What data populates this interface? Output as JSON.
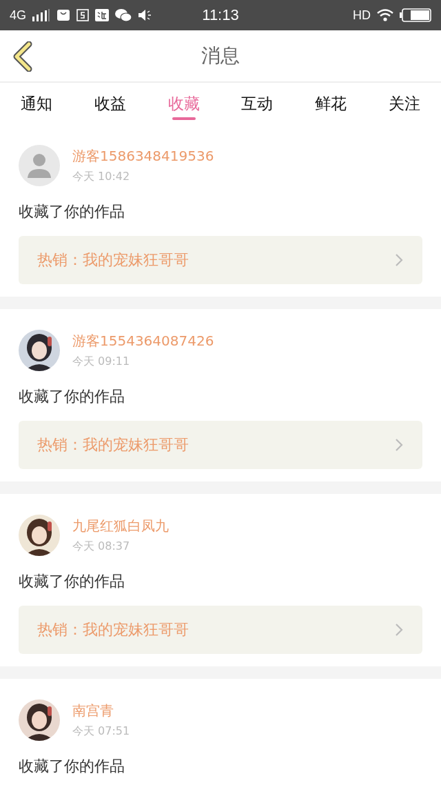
{
  "status_bar": {
    "network": "4G",
    "time": "11:13",
    "hd": "HD"
  },
  "header": {
    "title": "消息"
  },
  "tabs": [
    {
      "label": "通知",
      "selected": false
    },
    {
      "label": "收益",
      "selected": false
    },
    {
      "label": "收藏",
      "selected": true
    },
    {
      "label": "互动",
      "selected": false
    },
    {
      "label": "鲜花",
      "selected": false
    },
    {
      "label": "关注",
      "selected": false
    }
  ],
  "messages": [
    {
      "kind": "default",
      "name": "游客1586348419536",
      "time": "今天 10:42",
      "action": "收藏了你的作品",
      "link": "热销：我的宠妹狂哥哥"
    },
    {
      "kind": "picture",
      "name": "游客1554364087426",
      "time": "今天 09:11",
      "action": "收藏了你的作品",
      "link": "热销：我的宠妹狂哥哥"
    },
    {
      "kind": "picture",
      "name": "九尾红狐白凤九",
      "time": "今天 08:37",
      "action": "收藏了你的作品",
      "link": "热销：我的宠妹狂哥哥"
    },
    {
      "kind": "picture",
      "name": "南宫青",
      "time": "今天 07:51",
      "action": "收藏了你的作品"
    }
  ]
}
